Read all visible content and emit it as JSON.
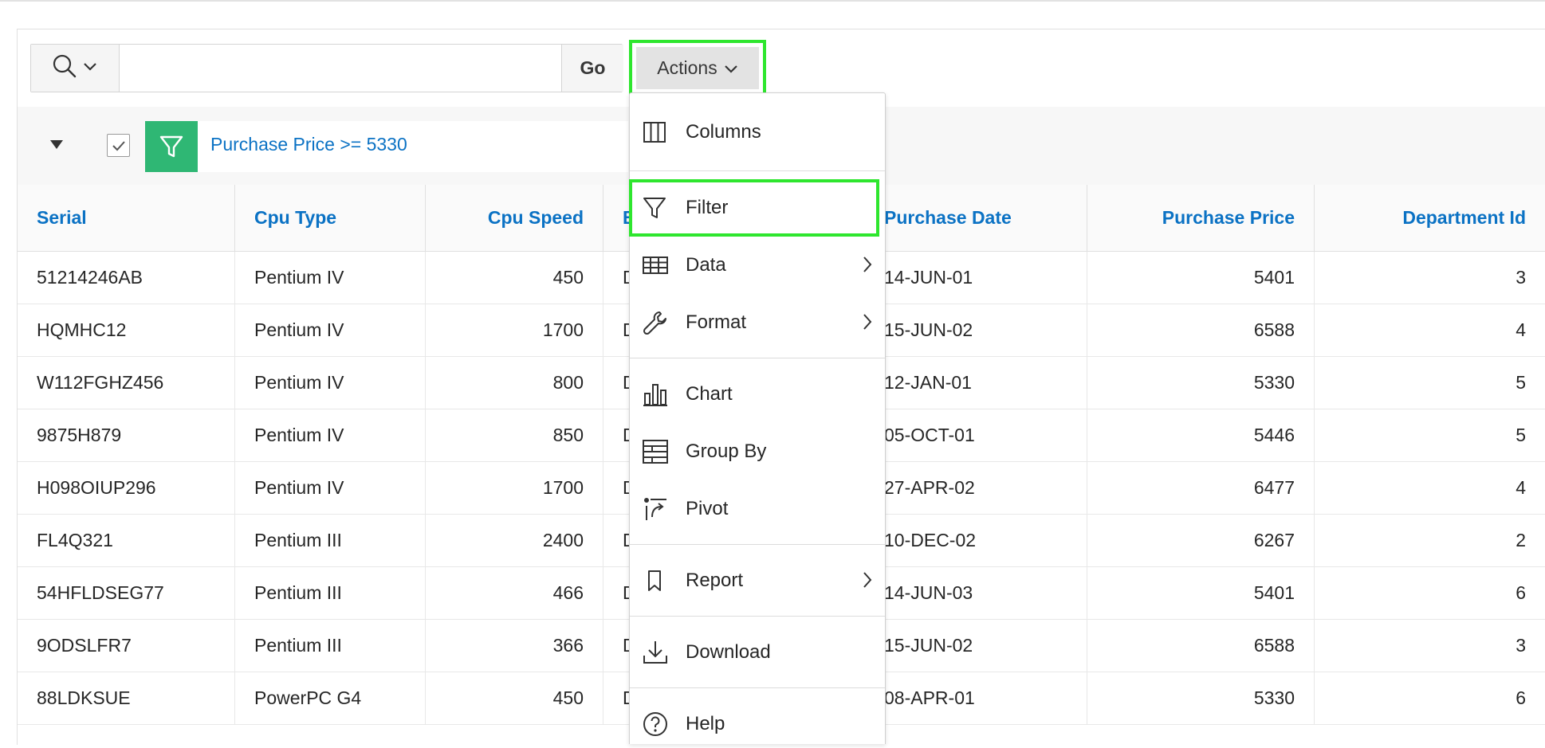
{
  "search": {
    "value": "",
    "placeholder": "",
    "go_label": "Go",
    "actions_label": "Actions"
  },
  "filter": {
    "text": "Purchase Price >= 5330",
    "enabled": true
  },
  "table": {
    "columns": [
      "Serial",
      "Cpu Type",
      "Cpu Speed",
      "B",
      "Purchase Date",
      "Purchase Price",
      "Department Id"
    ],
    "rows": [
      [
        "51214246AB",
        "Pentium IV",
        "450",
        "D",
        "14-JUN-01",
        "5401",
        "3"
      ],
      [
        "HQMHC12",
        "Pentium IV",
        "1700",
        "D",
        "15-JUN-02",
        "6588",
        "4"
      ],
      [
        "W112FGHZ456",
        "Pentium IV",
        "800",
        "D",
        "12-JAN-01",
        "5330",
        "5"
      ],
      [
        "9875H879",
        "Pentium IV",
        "850",
        "D",
        "05-OCT-01",
        "5446",
        "5"
      ],
      [
        "H098OIUP296",
        "Pentium IV",
        "1700",
        "D",
        "27-APR-02",
        "6477",
        "4"
      ],
      [
        "FL4Q321",
        "Pentium III",
        "2400",
        "D",
        "10-DEC-02",
        "6267",
        "2"
      ],
      [
        "54HFLDSEG77",
        "Pentium III",
        "466",
        "D",
        "14-JUN-03",
        "5401",
        "6"
      ],
      [
        "9ODSLFR7",
        "Pentium III",
        "366",
        "D",
        "15-JUN-02",
        "6588",
        "3"
      ],
      [
        "88LDKSUE",
        "PowerPC G4",
        "450",
        "D",
        "08-APR-01",
        "5330",
        "6"
      ]
    ]
  },
  "menu": {
    "items": [
      {
        "label": "Columns",
        "icon": "columns-icon",
        "submenu": false
      },
      {
        "label": "Filter",
        "icon": "filter-icon",
        "submenu": false,
        "highlighted": true
      },
      {
        "label": "Data",
        "icon": "table-icon",
        "submenu": true
      },
      {
        "label": "Format",
        "icon": "wrench-icon",
        "submenu": true
      },
      {
        "label": "Chart",
        "icon": "bar-chart-icon",
        "submenu": false
      },
      {
        "label": "Group By",
        "icon": "group-by-icon",
        "submenu": false
      },
      {
        "label": "Pivot",
        "icon": "pivot-icon",
        "submenu": false
      },
      {
        "label": "Report",
        "icon": "bookmark-icon",
        "submenu": true
      },
      {
        "label": "Download",
        "icon": "download-icon",
        "submenu": false
      },
      {
        "label": "Help",
        "icon": "help-icon",
        "submenu": false
      }
    ]
  },
  "colors": {
    "link": "#0b72c4",
    "filter_green": "#2fb774",
    "highlight": "#2ee62e"
  }
}
